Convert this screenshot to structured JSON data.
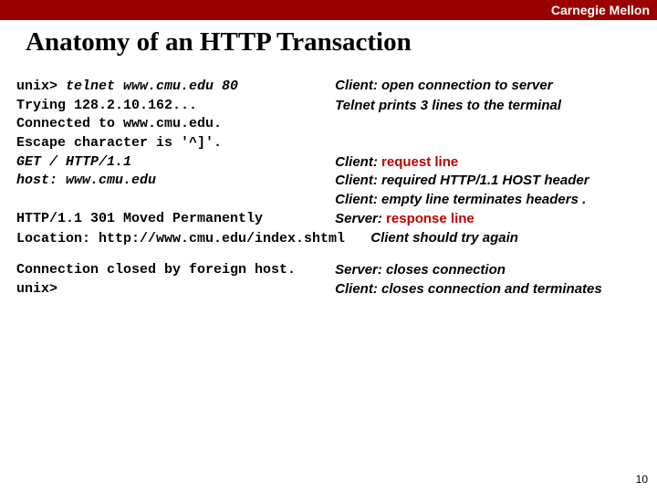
{
  "header": {
    "org": "Carnegie Mellon"
  },
  "title": "Anatomy of an HTTP Transaction",
  "lines": {
    "l1_cmd": "unix> ",
    "l1_cmd2": "telnet www.cmu.edu 80",
    "l1_lab": "Client: open connection to server",
    "l2_cmd": "Trying 128.2.10.162...",
    "l2_lab": "Telnet prints 3 lines to the terminal",
    "l3_cmd": "Connected to www.cmu.edu.",
    "l4_cmd": "Escape character is '^]'.",
    "l5_cmd": "GET / HTTP/1.1",
    "l5_labA": "Client: ",
    "l5_labB": "request line",
    "l6_cmd": "host: www.cmu.edu",
    "l6_lab": "Client: required HTTP/1.1 HOST header",
    "l7_lab": "Client: empty line terminates headers .",
    "l8_cmd": "HTTP/1.1 301 Moved Permanently",
    "l8_labA": "Server: ",
    "l8_labB": "response line",
    "l9_cmd": "Location: http://www.cmu.edu/index.shtml",
    "l9_lab": "Client should try again",
    "l10_cmd": "Connection closed by foreign host.",
    "l10_lab": "Server: closes connection",
    "l11_cmd": "unix>",
    "l11_lab": "Client: closes connection and terminates"
  },
  "page": "10"
}
